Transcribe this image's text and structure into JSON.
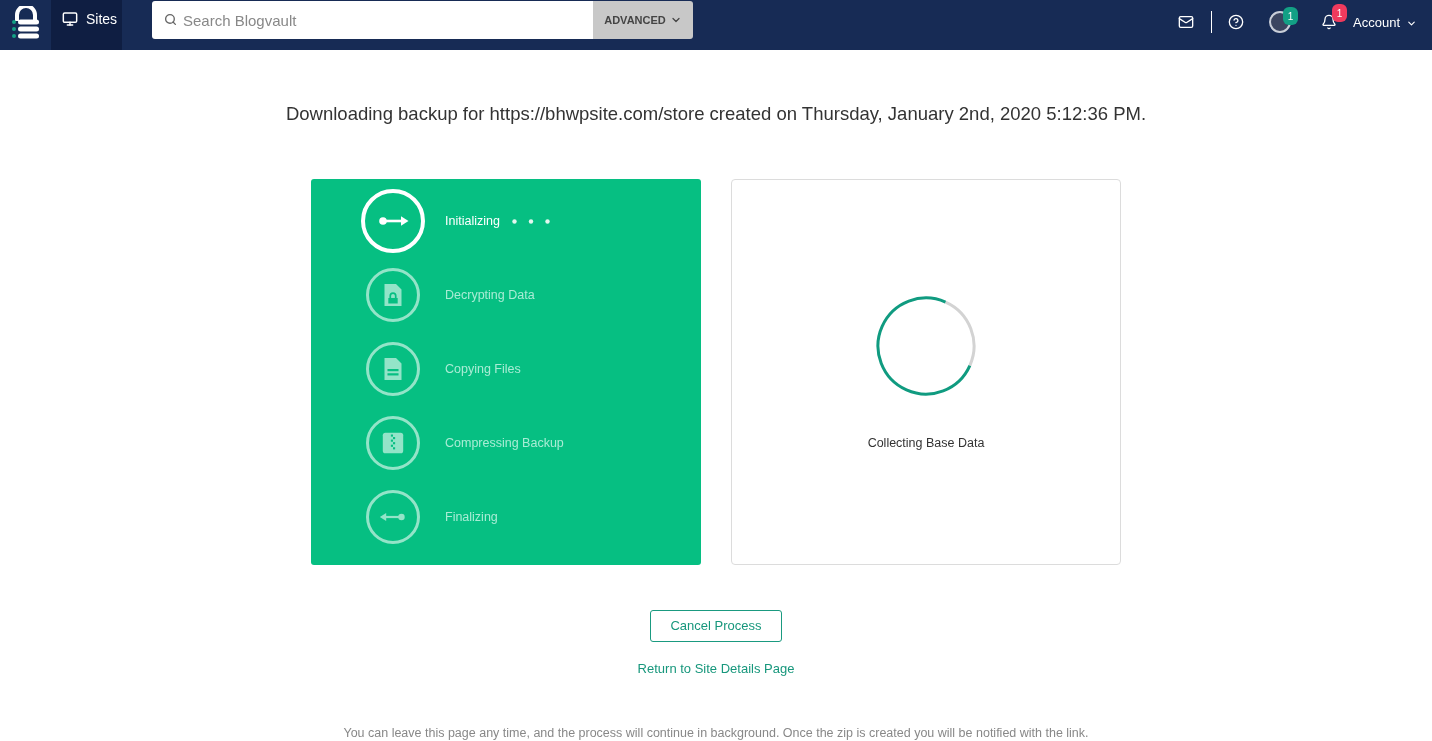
{
  "header": {
    "tabs": [
      {
        "label": "Sites",
        "selected": true
      }
    ],
    "search": {
      "placeholder": "Search Blogvault",
      "advanced_button": "ADVANCED"
    },
    "profile_badge": "1",
    "notifications_badge": "1",
    "account_menu": "Account"
  },
  "heading": "Downloading backup for https://bhwpsite.com/store created on Thursday, January 2nd, 2020 5:12:36 PM.",
  "steps": [
    {
      "label": "Initializing",
      "kind": "start",
      "active": true
    },
    {
      "label": "Decrypting Data",
      "kind": "locked-file",
      "active": false
    },
    {
      "label": "Copying Files",
      "kind": "file",
      "active": false
    },
    {
      "label": "Compressing Backup",
      "kind": "zip",
      "active": false
    },
    {
      "label": "Finalizing",
      "kind": "end",
      "active": false
    }
  ],
  "status": {
    "label": "Collecting Base Data"
  },
  "actions": {
    "cancel_button": "Cancel Process",
    "return_link": "Return to Site Details Page"
  },
  "footer_note": "You can leave this page any time, and the process will continue in background. Once the zip is created you will be notified with the link."
}
